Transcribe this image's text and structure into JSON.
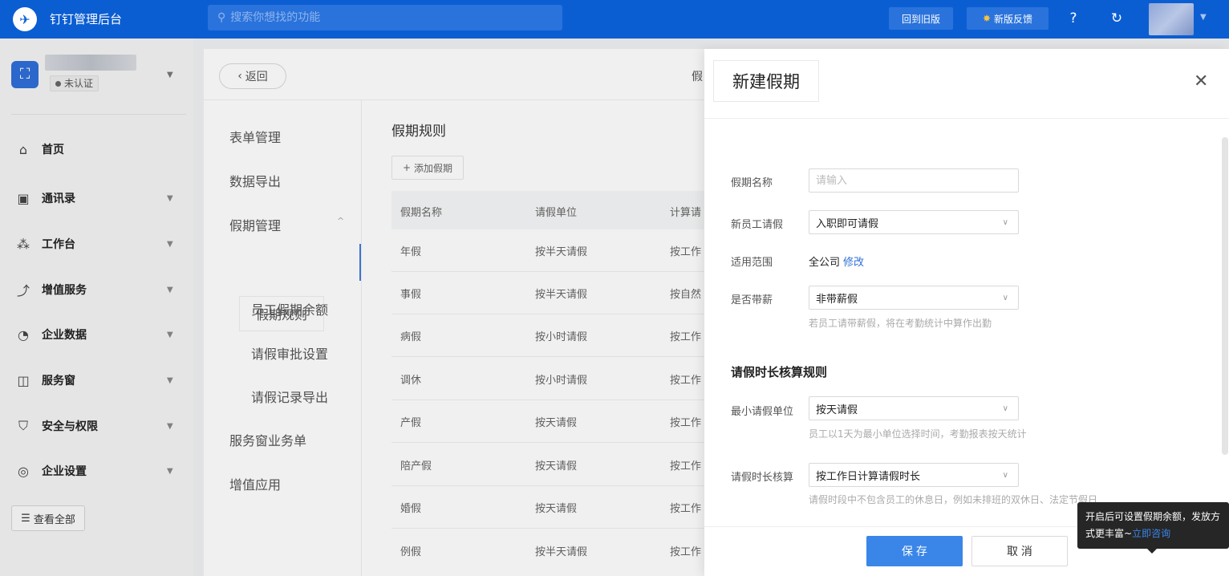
{
  "topbar": {
    "app_title": "钉钉管理后台",
    "search_placeholder": "搜索你想找的功能",
    "old_version_label": "回到旧版",
    "feedback_label": "新版反馈"
  },
  "sidebar": {
    "org_status": "未认证",
    "items": [
      {
        "label": "首页",
        "icon": "home-icon"
      },
      {
        "label": "通讯录",
        "icon": "contacts-icon"
      },
      {
        "label": "工作台",
        "icon": "workbench-icon"
      },
      {
        "label": "增值服务",
        "icon": "trend-icon"
      },
      {
        "label": "企业数据",
        "icon": "data-icon"
      },
      {
        "label": "服务窗",
        "icon": "service-icon"
      },
      {
        "label": "安全与权限",
        "icon": "shield-icon"
      },
      {
        "label": "企业设置",
        "icon": "settings-icon"
      }
    ],
    "view_all_label": "查看全部"
  },
  "main": {
    "back_label": "返回",
    "crumb_fragment": "假",
    "subnav": [
      "表单管理",
      "数据导出",
      "假期管理",
      "假期规则",
      "员工假期余额",
      "请假审批设置",
      "请假记录导出",
      "服务窗业务单",
      "增值应用"
    ],
    "rules_title": "假期规则",
    "add_label": "添加假期",
    "table": {
      "headers": [
        "假期名称",
        "请假单位",
        "计算请"
      ],
      "rows": [
        [
          "年假",
          "按半天请假",
          "按工作"
        ],
        [
          "事假",
          "按半天请假",
          "按自然"
        ],
        [
          "病假",
          "按小时请假",
          "按工作"
        ],
        [
          "调休",
          "按小时请假",
          "按工作"
        ],
        [
          "产假",
          "按天请假",
          "按工作"
        ],
        [
          "陪产假",
          "按天请假",
          "按工作"
        ],
        [
          "婚假",
          "按天请假",
          "按工作"
        ],
        [
          "例假",
          "按半天请假",
          "按工作"
        ]
      ]
    }
  },
  "drawer": {
    "title": "新建假期",
    "fields": {
      "name_label": "假期名称",
      "name_placeholder": "请输入",
      "newhire_label": "新员工请假",
      "newhire_value": "入职即可请假",
      "scope_label": "适用范围",
      "scope_value": "全公司",
      "scope_edit": "修改",
      "paid_label": "是否带薪",
      "paid_value": "非带薪假",
      "paid_hint": "若员工请带薪假，将在考勤统计中算作出勤"
    },
    "section_title": "请假时长核算规则",
    "fields2": {
      "min_unit_label": "最小请假单位",
      "min_unit_value": "按天请假",
      "min_unit_hint": "员工以1天为最小单位选择时间，考勤报表按天统计",
      "calc_label": "请假时长核算",
      "calc_value": "按工作日计算请假时长",
      "calc_hint": "请假时段中不包含员工的休息日，例如未排班的双休日、法定节假日"
    },
    "save_label": "保 存",
    "cancel_label": "取 消"
  },
  "tooltip": {
    "text": "开启后可设置假期余额，发放方式更丰富~",
    "link": "立即咨询"
  }
}
